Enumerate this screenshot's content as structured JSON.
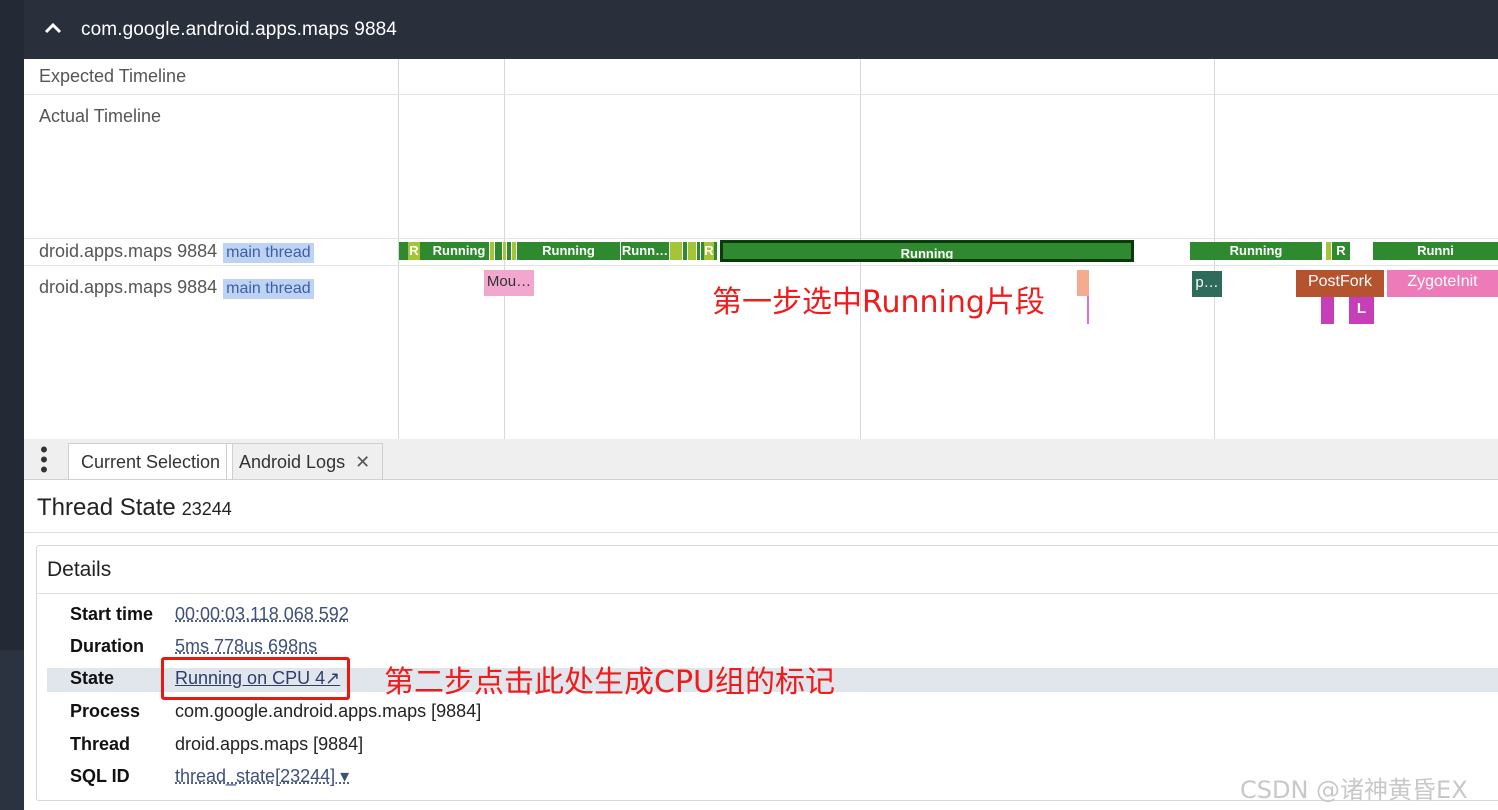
{
  "header": {
    "chevron": "^",
    "process_title": "com.google.android.apps.maps 9884"
  },
  "tracks": {
    "expected_label": "Expected Timeline",
    "actual_label": "Actual Timeline",
    "thread_rows": [
      {
        "name": "droid.apps.maps 9884",
        "tag": "main thread"
      },
      {
        "name": "droid.apps.maps 9884",
        "tag": "main thread"
      }
    ],
    "state_segments": [
      "R",
      "Running",
      "Running",
      "Runn…",
      "R",
      "Running",
      "Running",
      "R",
      "Runni"
    ],
    "slices": [
      "Mou…",
      "p…",
      "PostFork",
      "ZygoteInit",
      "L"
    ]
  },
  "annotations": {
    "step1": "第一步选中Running片段",
    "step2": "第二步点击此处生成CPU组的标记"
  },
  "tabs": {
    "menu_icon": "⋮",
    "current_selection": "Current Selection",
    "android_logs": "Android Logs",
    "close": "✕"
  },
  "panel": {
    "title": "Thread State",
    "id": "23244",
    "details_heading": "Details",
    "rows": [
      {
        "key": "Start time",
        "value": "00:00:03.118 068 592"
      },
      {
        "key": "Duration",
        "value": "5ms 778us 698ns"
      },
      {
        "key": "State",
        "value": "Running on CPU 4↗"
      },
      {
        "key": "Process",
        "value": "com.google.android.apps.maps [9884]"
      },
      {
        "key": "Thread",
        "value": "droid.apps.maps [9884]"
      },
      {
        "key": "SQL ID",
        "value": "thread_state[23244] ▾"
      }
    ]
  },
  "watermark": "CSDN @诸神黄昏EX",
  "colors": {
    "header_bg": "#29303c",
    "running_green": "#2f8a2f",
    "runnable_lime": "#a6c43a",
    "selected_outline": "#0b3a0b",
    "annotation_red": "#ee1c1c",
    "postfork": "#b5532e",
    "zygoteinit": "#ee7bb9",
    "mou_pink": "#f2a7cf",
    "p_teal": "#2e6b5b",
    "l_purple": "#c73fb8"
  }
}
